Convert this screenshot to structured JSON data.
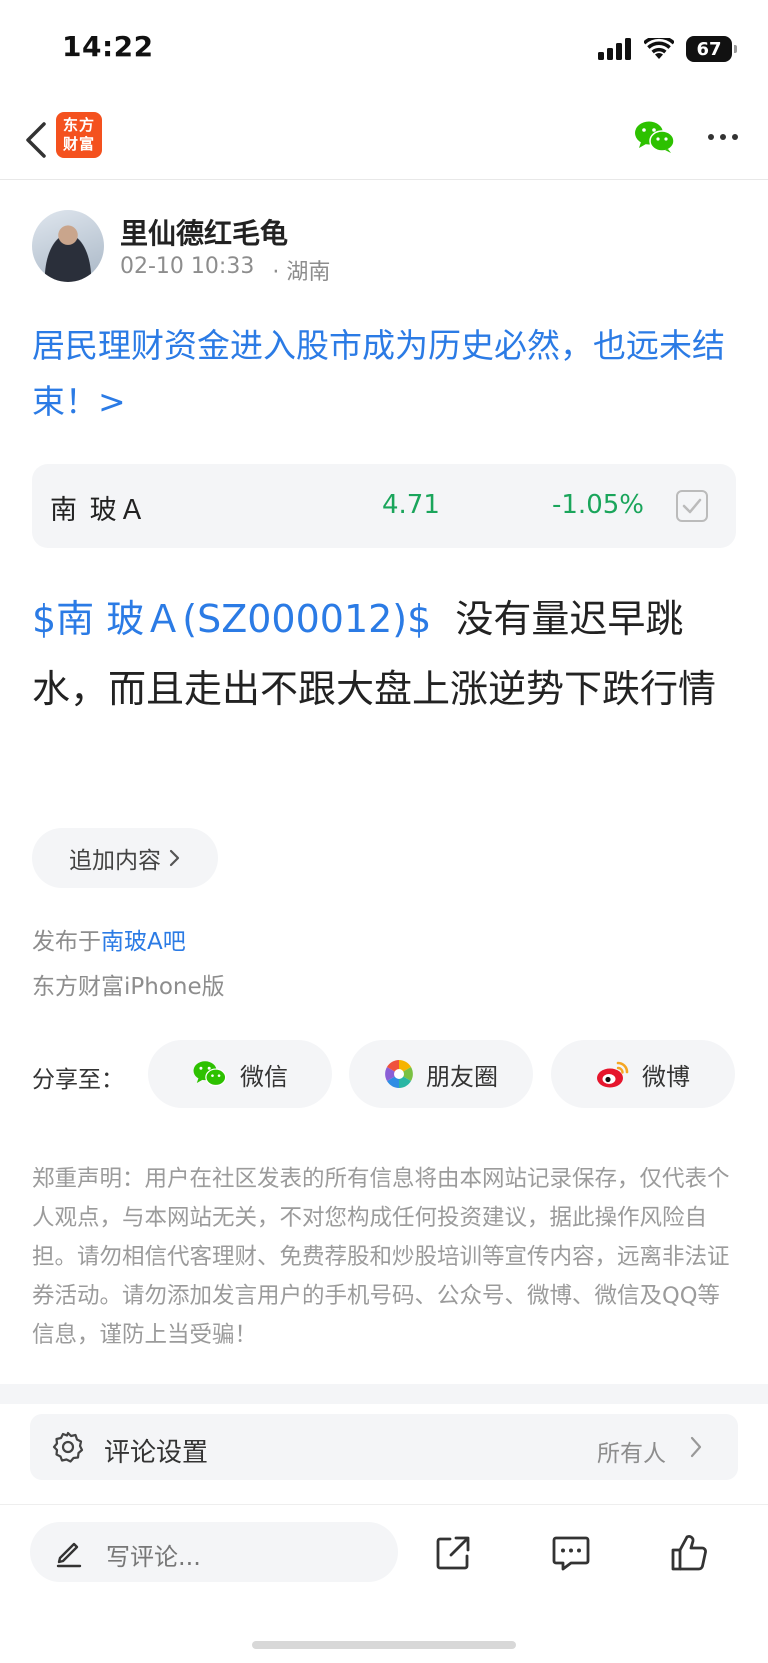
{
  "status_bar": {
    "time": "14:22",
    "battery": "67"
  },
  "nav": {
    "logo_line1": "东方",
    "logo_line2": "财富"
  },
  "author": {
    "name": "里仙德红毛龟",
    "datetime": "02-10 10:33",
    "location": "· 湖南"
  },
  "post": {
    "title": "居民理财资金进入股市成为历史必然，也远未结束！>",
    "stock_tag": "$南  玻Ａ(SZ000012)$",
    "body_text": "没有量迟早跳水，而且走出不跟大盘上涨逆势下跌行情"
  },
  "stock_card": {
    "name": "南 玻Ａ",
    "price": "4.71",
    "change": "-1.05%",
    "colors": {
      "down": "#1aa55b"
    }
  },
  "actions": {
    "add_content": "追加内容"
  },
  "source": {
    "prefix": "发布于",
    "bar_name": "南玻A吧",
    "client": "东方财富iPhone版"
  },
  "share": {
    "label": "分享至：",
    "items": [
      {
        "label": "微信",
        "icon": "wechat-icon"
      },
      {
        "label": "朋友圈",
        "icon": "moments-icon"
      },
      {
        "label": "微博",
        "icon": "weibo-icon"
      }
    ]
  },
  "disclaimer": "郑重声明：用户在社区发表的所有信息将由本网站记录保存，仅代表个人观点，与本网站无关，不对您构成任何投资建议，据此操作风险自担。请勿相信代客理财、免费荐股和炒股培训等宣传内容，远离非法证券活动。请勿添加发言用户的手机号码、公众号、微博、微信及QQ等信息，谨防上当受骗！",
  "comment_setting": {
    "label": "评论设置",
    "value": "所有人"
  },
  "bottom_bar": {
    "placeholder": "写评论..."
  },
  "theme": {
    "link": "#2b7be5",
    "brand": "#f4511e",
    "wechat": "#2dc100"
  }
}
